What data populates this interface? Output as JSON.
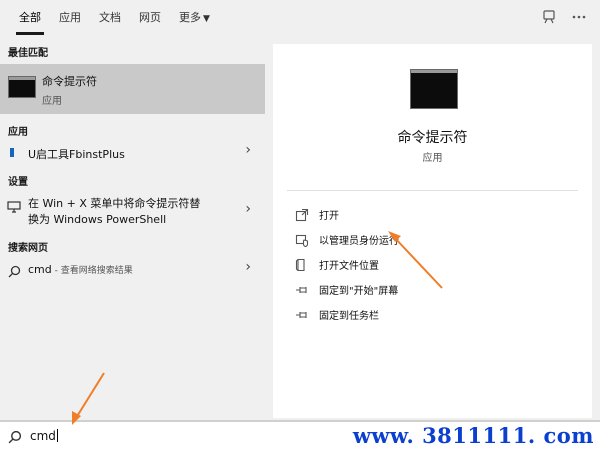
{
  "tabs": [
    {
      "label": "全部"
    },
    {
      "label": "应用"
    },
    {
      "label": "文档"
    },
    {
      "label": "网页"
    },
    {
      "label": "更多"
    }
  ],
  "top_icons": [
    "feedback-icon",
    "more-icon"
  ],
  "sections": {
    "best_match": "最佳匹配",
    "apps": "应用",
    "settings": "设置",
    "web": "搜索网页"
  },
  "best_match": {
    "title": "命令提示符",
    "subtitle": "应用"
  },
  "apps_item": {
    "title": "U启工具FbinstPlus"
  },
  "settings_item": {
    "line1": "在 Win + X 菜单中将命令提示符替",
    "line2": "换为 Windows PowerShell"
  },
  "web_item": {
    "query": "cmd",
    "suffix": " - 查看网络搜索结果"
  },
  "preview": {
    "title": "命令提示符",
    "subtitle": "应用"
  },
  "actions": [
    {
      "label": "打开",
      "icon": "open-icon"
    },
    {
      "label": "以管理员身份运行",
      "icon": "admin-shield-icon"
    },
    {
      "label": "打开文件位置",
      "icon": "file-location-icon"
    },
    {
      "label": "固定到\"开始\"屏幕",
      "icon": "pin-icon"
    },
    {
      "label": "固定到任务栏",
      "icon": "pin-icon"
    }
  ],
  "search": {
    "value": "cmd"
  },
  "watermark": "www. 3811111. com",
  "colors": {
    "annotation_arrow": "#f07d28",
    "watermark": "#0a3fcf",
    "selected_row": "#c9c9c9"
  }
}
